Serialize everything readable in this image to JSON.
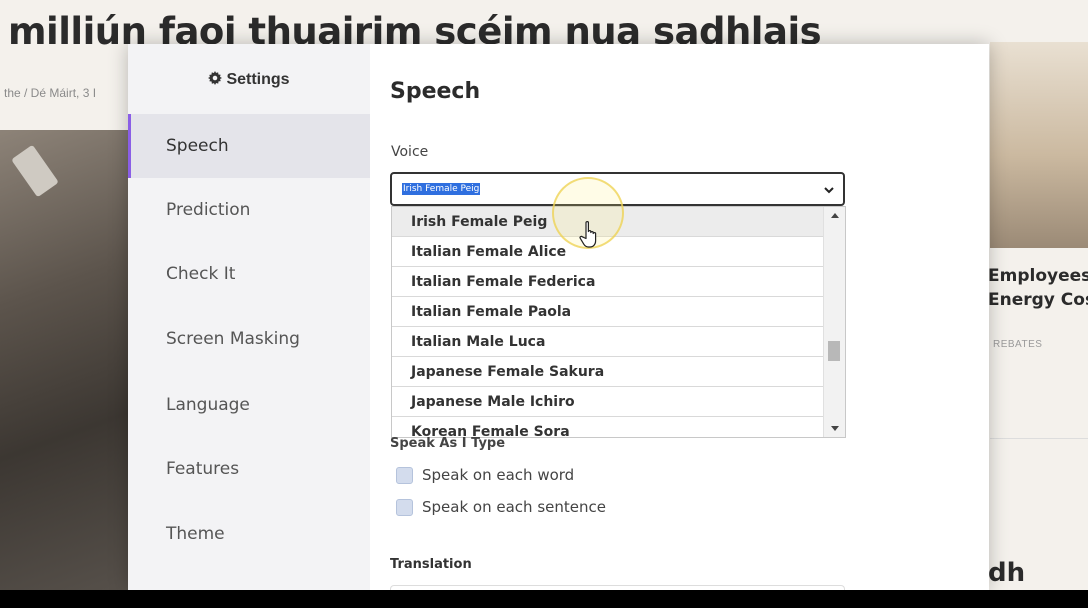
{
  "background": {
    "headline": "milliún faoi thuairim scéim nua sadhlais",
    "byline": "the / Dé Máirt, 3 I",
    "card_title_lines": [
      "Employees",
      "Energy Cos"
    ],
    "card_tag": "REBATES",
    "fragment": "dh"
  },
  "settings": {
    "header": "Settings",
    "nav": [
      "Speech",
      "Prediction",
      "Check It",
      "Screen Masking",
      "Language",
      "Features",
      "Theme"
    ],
    "active_nav": "Speech",
    "accent_color": "#8a5ee6"
  },
  "speech": {
    "title": "Speech",
    "voice_label": "Voice",
    "selected_voice": "Irish Female Peig",
    "voice_options": [
      "Irish Female Peig",
      "Italian Female Alice",
      "Italian Female Federica",
      "Italian Female Paola",
      "Italian Male Luca",
      "Japanese Female Sakura",
      "Japanese Male Ichiro",
      "Korean Female Sora"
    ],
    "hovered_option": "Irish Female Peig",
    "speak_as_i_type_label": "Speak As I Type",
    "speak_options": [
      "Speak on each word",
      "Speak on each sentence"
    ],
    "translation_label": "Translation"
  },
  "icons": {
    "settings": "gear-icon",
    "select": "chevron-down-icon",
    "cursor": "hand-pointer-icon"
  }
}
